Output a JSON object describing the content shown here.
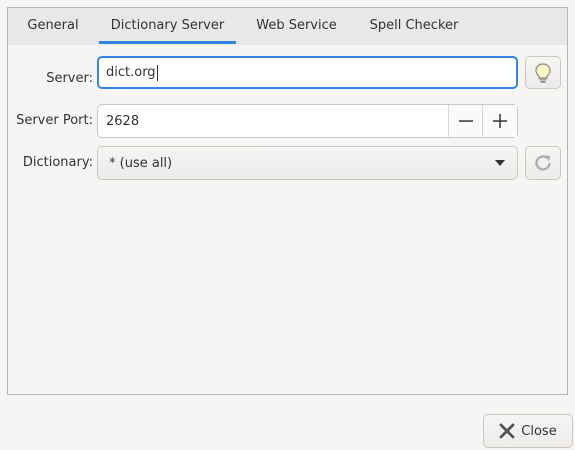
{
  "tabs": [
    {
      "label": "General"
    },
    {
      "label": "Dictionary Server"
    },
    {
      "label": "Web Service"
    },
    {
      "label": "Spell Checker"
    }
  ],
  "active_tab": "Dictionary Server",
  "server": {
    "label": "Server:",
    "value": "dict.org"
  },
  "port": {
    "label": "Server Port:",
    "value": "2628"
  },
  "dictionary": {
    "label": "Dictionary:",
    "selected": "* (use all)"
  },
  "footer": {
    "close_label": "Close"
  },
  "colors": {
    "accent": "#3584e4",
    "background": "#f6f5f4"
  },
  "icons": {
    "server_button": "lightbulb-icon",
    "dictionary_button": "refresh-icon",
    "spin_minus": "minus-icon",
    "spin_plus": "plus-icon",
    "combo_arrow": "dropdown-arrow-icon",
    "close": "close-icon"
  }
}
